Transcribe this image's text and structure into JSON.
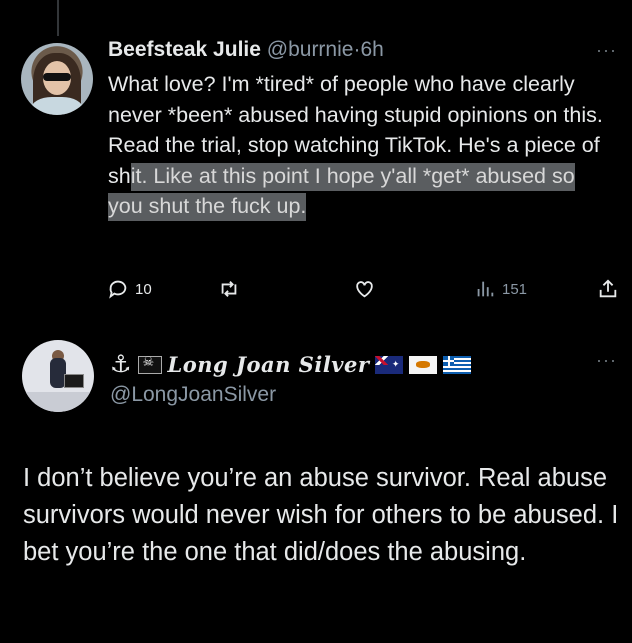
{
  "tweet1": {
    "author_name": "Beefsteak Julie",
    "handle": "@burrnie",
    "separator": "·",
    "time": "6h",
    "more_label": "···",
    "text_plain": "What love? I'm *tired* of people who have clearly never *been* abused having stupid opinions on this. Read the trial, stop watching TikTok. He's a piece of sh",
    "text_highlighted": "it. Like at this point I hope y'all *get* abused so you shut the fuck up.",
    "actions": {
      "reply_count": "10",
      "retweet_count": "",
      "like_count": "",
      "views_count": "151"
    },
    "avatar_icon": "profile-photo"
  },
  "tweet2": {
    "display_name_prefix": "⚓",
    "display_name": "Long Joan Silver",
    "handle": "@LongJoanSilver",
    "more_label": "···",
    "text": "I don’t believe you’re an abuse survivor. Real abuse survivors would never wish for others to be abused. I bet you’re the one that did/does the abusing.",
    "flags": [
      "pirate-flag",
      "australia-flag",
      "cyprus-flag",
      "greece-flag"
    ],
    "avatar_icon": "profile-photo"
  },
  "colors": {
    "background": "#000000",
    "text": "#e7e9ea",
    "secondary_text": "#8b98a5",
    "highlight": "#5a5d60"
  }
}
